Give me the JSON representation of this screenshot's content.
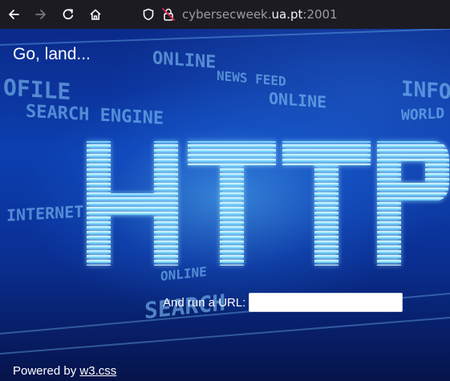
{
  "browser": {
    "url_prefix": "cybersecweek.",
    "url_host": "ua.pt",
    "url_suffix": ":2001",
    "icons": [
      "back-arrow-icon",
      "forward-arrow-icon",
      "reload-icon",
      "home-icon",
      "shield-icon",
      "insecure-lock-icon"
    ]
  },
  "page": {
    "greeting": "Go, land...",
    "form": {
      "label": "And run a URL:",
      "input_value": ""
    },
    "footer": {
      "prefix": "Powered by ",
      "link": "w3.css"
    }
  },
  "colors": {
    "toolbar_bg": "#1c1b22",
    "page_bg": "#0c3fb0",
    "accent_glow": "#5abeff"
  }
}
